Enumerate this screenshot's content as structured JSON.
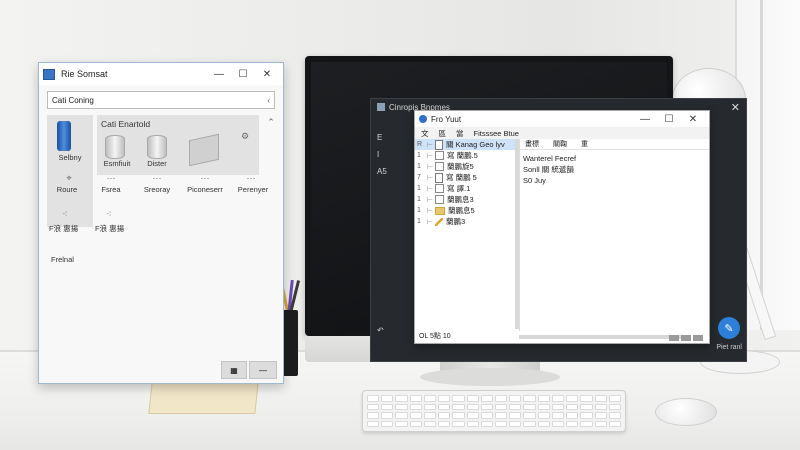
{
  "control_panel": {
    "title": "Rie Somsat",
    "address": "Cati Coning",
    "group_title": "Cati Enartold",
    "items_large": [
      {
        "label": "Selbny",
        "icon": "bottle-icon"
      },
      {
        "label": "Esmfiuit",
        "icon": "drum-icon"
      },
      {
        "label": "Dister",
        "icon": "drum-icon"
      },
      {
        "label": "",
        "icon": "tray-icon"
      }
    ],
    "items_small": [
      {
        "label": "Roure",
        "icon": "pin-icon"
      },
      {
        "label": "Fsrea",
        "icon": "dots-icon"
      },
      {
        "label": "Sreoray",
        "icon": "dots-icon"
      },
      {
        "label": "Piconeserr",
        "icon": "dots-icon"
      },
      {
        "label": "Perenyer",
        "icon": "dots-icon"
      }
    ],
    "dropdowns": [
      {
        "label": "F浪 惠揚"
      },
      {
        "label": "F浪 惠揚"
      }
    ],
    "section_label": "Frelnal"
  },
  "dark_window": {
    "title": "Cinropis Bnpmes",
    "side_items": [
      "E",
      "I",
      "A5"
    ],
    "launch_label": "Piet ranl"
  },
  "explorer": {
    "title": "Fro Yuut",
    "menu": [
      "文",
      "區",
      "當",
      "Fitsssee Btue"
    ],
    "columns": [
      "畫標",
      "關鞠",
      "重"
    ],
    "tree": [
      {
        "gut": "R",
        "text": "關 Kanag Geo lyv",
        "icon": "doc",
        "selected": true
      },
      {
        "gut": "1",
        "text": "寫 蘭鵬.5",
        "icon": "chk"
      },
      {
        "gut": "1",
        "text": "蘭鵬旋5",
        "icon": "chk"
      },
      {
        "gut": "7",
        "text": "寫 蘭鵬 5",
        "icon": "doc"
      },
      {
        "gut": "1",
        "text": "寫 譯.1",
        "icon": "chk"
      },
      {
        "gut": "1",
        "text": "蘭鵬息3",
        "icon": "chk"
      },
      {
        "gut": "1",
        "text": "蘭鵬息5",
        "icon": "fold"
      },
      {
        "gut": "1",
        "text": "蘭鵬3",
        "icon": "pen"
      }
    ],
    "details": [
      "Wanterel Fecref",
      "Sonll 關 統遞韻",
      "S0 Juy"
    ],
    "status": "OL 5點 10"
  }
}
